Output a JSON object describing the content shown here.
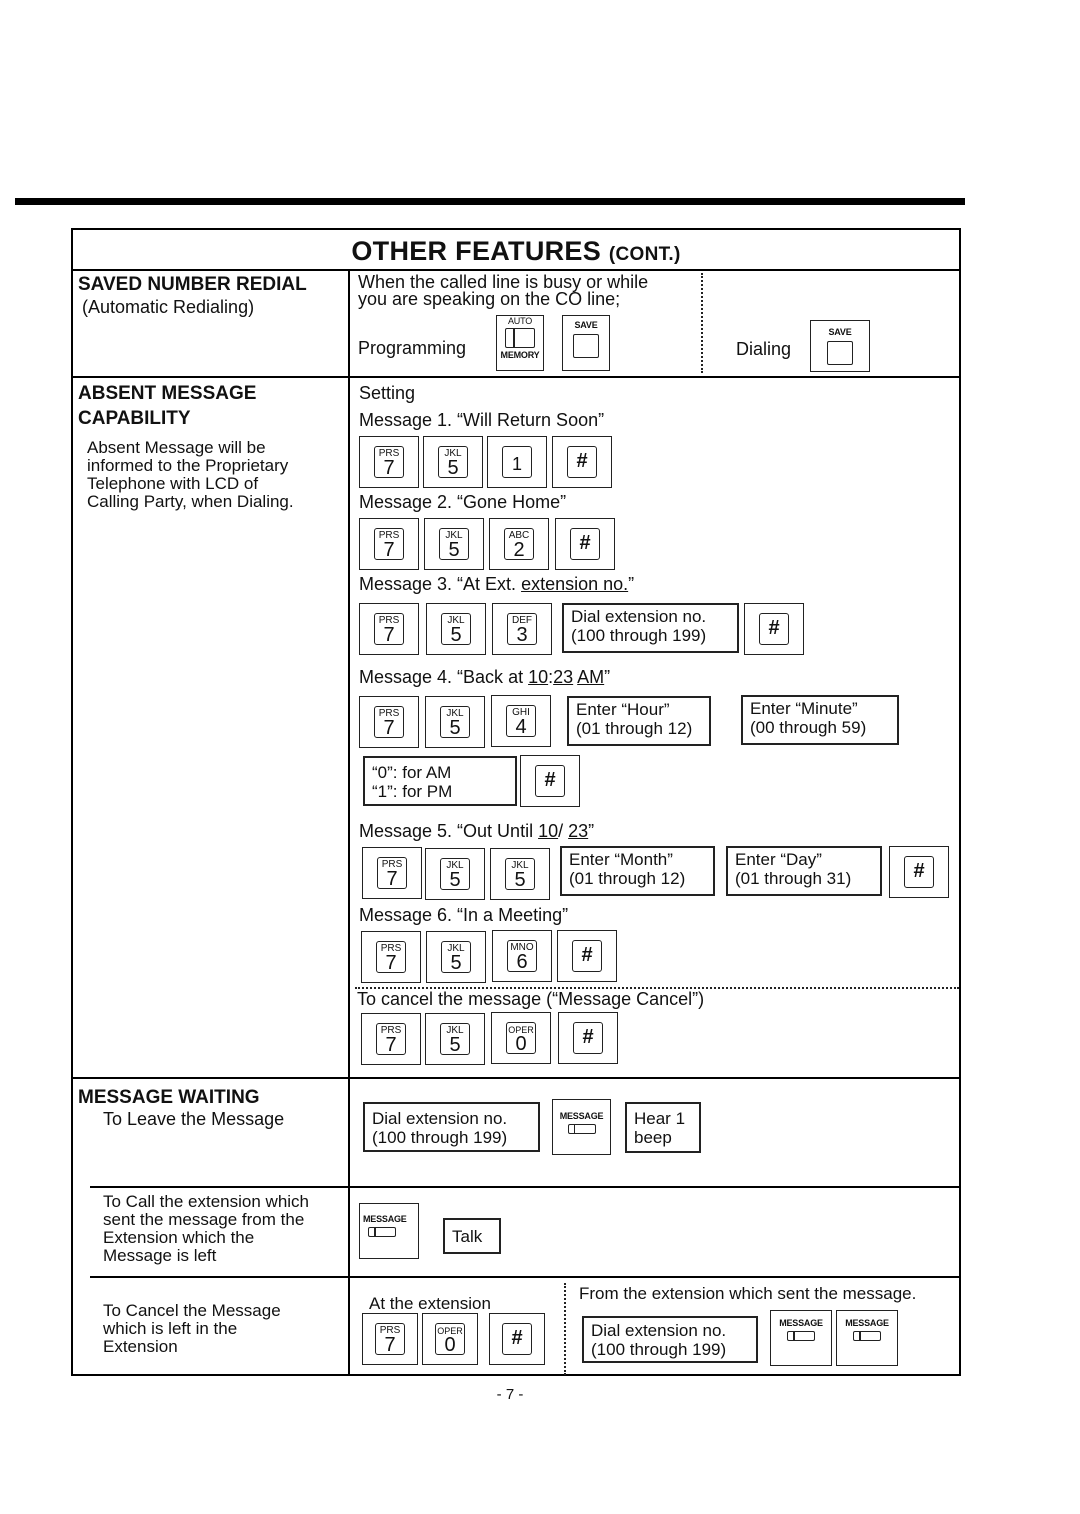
{
  "title": {
    "main": "OTHER FEATURES",
    "cont": "(CONT.)"
  },
  "page_number": "- 7 -",
  "saved_number_redial": {
    "heading": "SAVED NUMBER REDIAL",
    "subheading": "(Automatic Redialing)",
    "condition_line1": "When the called line is busy or while",
    "condition_line2": "you are speaking on the CO line;",
    "programming_label": "Programming",
    "auto_label": "AUTO",
    "memory_label": "MEMORY",
    "save_label": "SAVE",
    "dialing_label": "Dialing"
  },
  "absent_message": {
    "heading_line1": "ABSENT MESSAGE",
    "heading_line2": "CAPABILITY",
    "desc": [
      "Absent Message will be",
      "informed to the Proprietary",
      "Telephone with LCD of",
      "Calling Party, when Dialing."
    ],
    "setting_label": "Setting",
    "messages": [
      {
        "label": "Message 1. “Will Return Soon”"
      },
      {
        "label": "Message 2. “Gone Home”"
      },
      {
        "label_prefix": "Message 3. “At Ext. ",
        "label_u": "extension no.",
        "label_suffix": "”"
      },
      {
        "label_prefix": "Message 4. “Back at ",
        "h": "10",
        "sep": ":",
        "m": "23",
        "ampm": "AM",
        "label_suffix": "”"
      },
      {
        "label_prefix": "Message 5. “Out Until ",
        "mo": "10",
        "sep": "/",
        "d": "23",
        "label_suffix": "”"
      },
      {
        "label": "Message 6. “In a Meeting”"
      }
    ],
    "cancel_label": "To cancel the message (“Message Cancel”)",
    "keys": {
      "k7": {
        "sub": "PRS",
        "num": "7"
      },
      "k5": {
        "sub": "JKL",
        "num": "5"
      },
      "k1": {
        "num": "1"
      },
      "k2": {
        "sub": "ABC",
        "num": "2"
      },
      "k3": {
        "sub": "DEF",
        "num": "3"
      },
      "k4": {
        "sub": "GHI",
        "num": "4"
      },
      "k6": {
        "sub": "MNO",
        "num": "6"
      },
      "k0": {
        "sub": "OPER",
        "num": "0"
      },
      "hash": {
        "num": "#"
      }
    },
    "dial_ext": [
      "Dial extension no.",
      "(100 through 199)"
    ],
    "enter_hour": [
      "Enter “Hour”",
      "(01 through 12)"
    ],
    "enter_minute": [
      "Enter “Minute”",
      "(00 through 59)"
    ],
    "ampm_box": [
      "“0”: for AM",
      "“1”: for PM"
    ],
    "enter_month": [
      "Enter “Month”",
      "(01 through 12)"
    ],
    "enter_day": [
      "Enter “Day”",
      "(01 through 31)"
    ]
  },
  "message_waiting": {
    "heading": "MESSAGE WAITING",
    "leave_label": "To Leave the Message",
    "call_label": [
      "To Call the extension which",
      "sent the message from the",
      "Extension which the",
      "Message is left"
    ],
    "cancel_label": [
      "To Cancel the Message",
      "which is left in the",
      "Extension"
    ],
    "dial_ext": [
      "Dial extension no.",
      "(100 through 199)"
    ],
    "message_key": "MESSAGE",
    "hear_beep": [
      "Hear 1",
      "beep"
    ],
    "talk": "Talk",
    "at_extension": "At the extension",
    "from_extension": "From the extension which sent the message."
  }
}
